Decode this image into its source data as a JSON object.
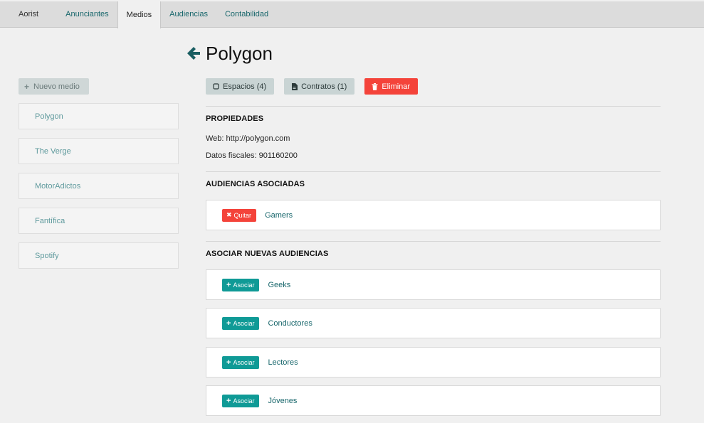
{
  "nav": {
    "brand": "Aorist",
    "tabs": [
      "Anunciantes",
      "Medios",
      "Audiencias",
      "Contabilidad"
    ],
    "active_tab": "Medios"
  },
  "sidebar": {
    "new_button": "Nuevo medio",
    "items": [
      "Polygon",
      "The Verge",
      "MotorAdictos",
      "Fantífica",
      "Spotify"
    ]
  },
  "main": {
    "title": "Polygon",
    "actions": {
      "spaces": "Espacios (4)",
      "contracts": "Contratos (1)",
      "delete": "Eliminar"
    },
    "properties": {
      "heading": "PROPIEDADES",
      "web": "Web: http://polygon.com",
      "fiscal": "Datos fiscales: 901160200"
    },
    "associated": {
      "heading": "AUDIENCIAS ASOCIADAS",
      "remove_label": "Quitar",
      "items": [
        "Gamers"
      ]
    },
    "new_audiences": {
      "heading": "ASOCIAR NUEVAS AUDIENCIAS",
      "associate_label": "Asociar",
      "items": [
        "Geeks",
        "Conductores",
        "Lectores",
        "Jóvenes"
      ]
    }
  },
  "colors": {
    "teal": "#0f9a96",
    "link": "#17666b",
    "danger": "#f4433a",
    "nav_bg": "#dcdcdc"
  }
}
